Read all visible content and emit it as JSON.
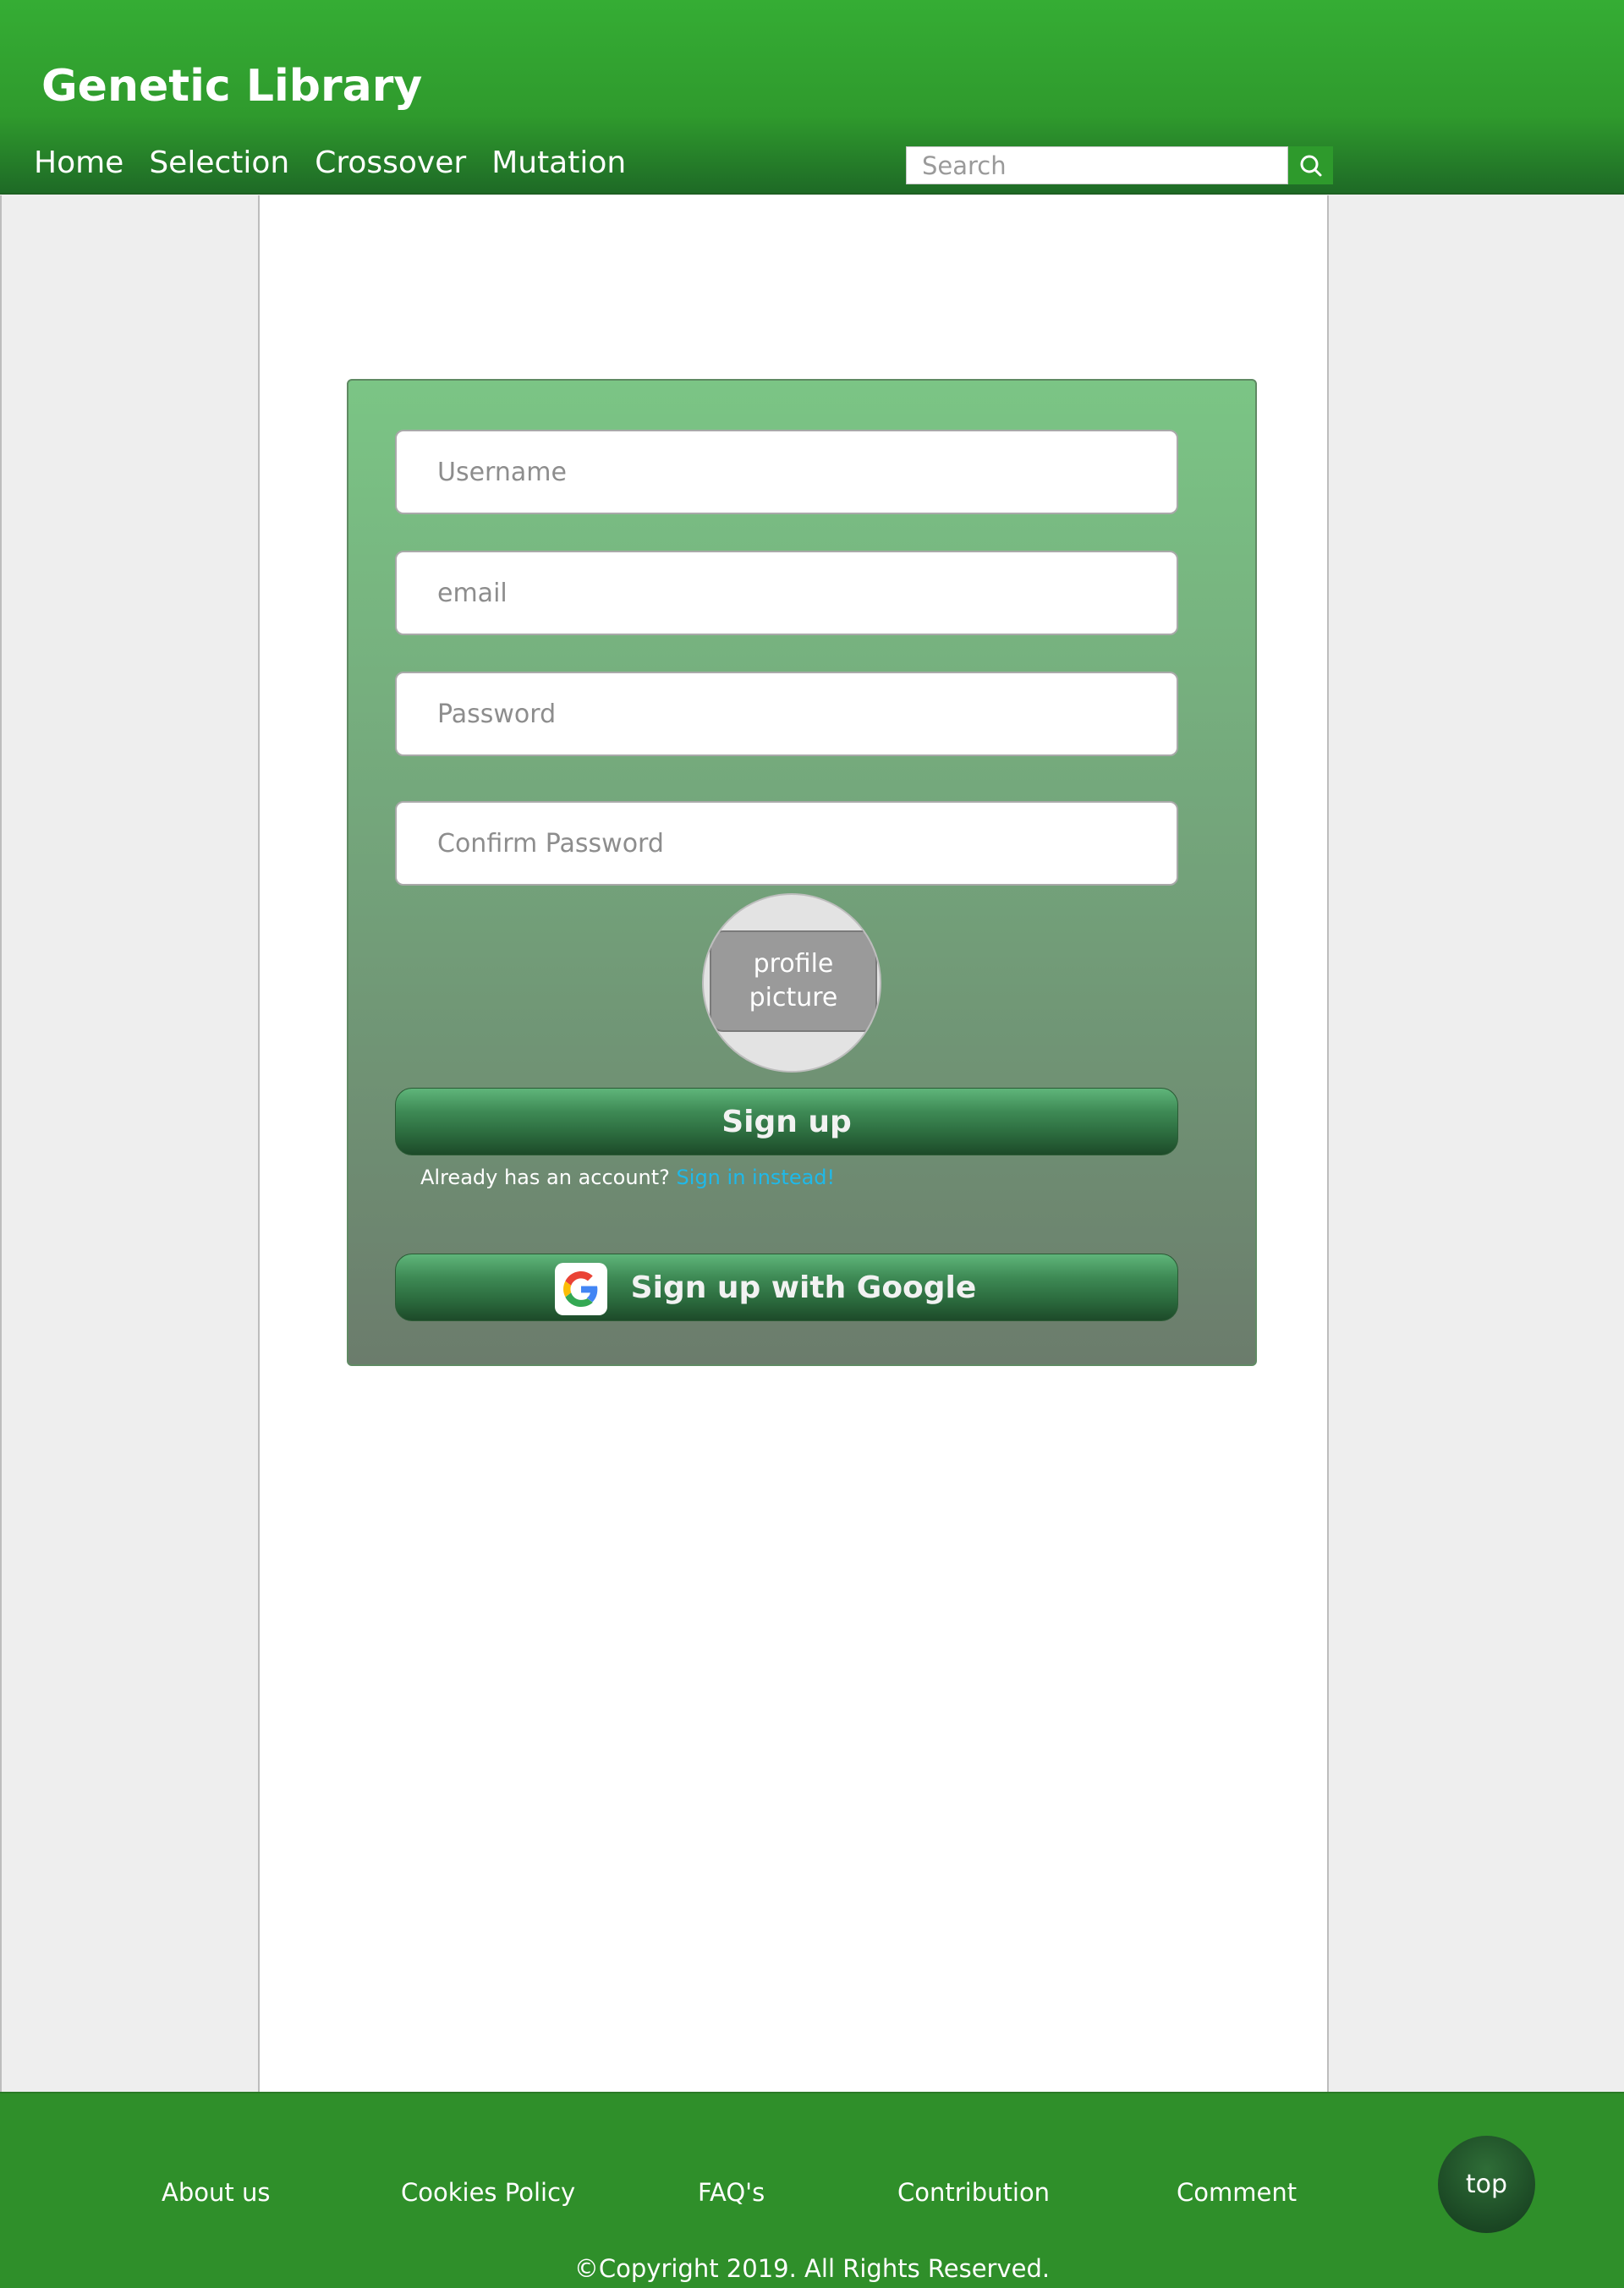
{
  "header": {
    "title": "Genetic Library",
    "nav": [
      "Home",
      "Selection",
      "Crossover",
      "Mutation"
    ],
    "search_placeholder": "Search"
  },
  "form": {
    "username_placeholder": "Username",
    "email_placeholder": "email",
    "password_placeholder": "Password",
    "confirm_placeholder": "Confirm Password",
    "profile_picture_label": "profile\npicture",
    "signup_label": "Sign up",
    "already_text": "Already has an account? ",
    "signin_link": "Sign in instead!",
    "google_label": "Sign up with Google"
  },
  "footer": {
    "links": [
      "About us",
      "Cookies Policy",
      "FAQ's",
      "Contribution",
      "Comment"
    ],
    "top_label": "top",
    "copyright": "©Copyright 2019. All Rights Reserved."
  },
  "colors": {
    "header_green": "#35ad34",
    "footer_green": "#2f8f2a",
    "link_blue": "#1fb9e9"
  },
  "icons": {
    "search": "search-icon",
    "google": "google-g-icon"
  }
}
